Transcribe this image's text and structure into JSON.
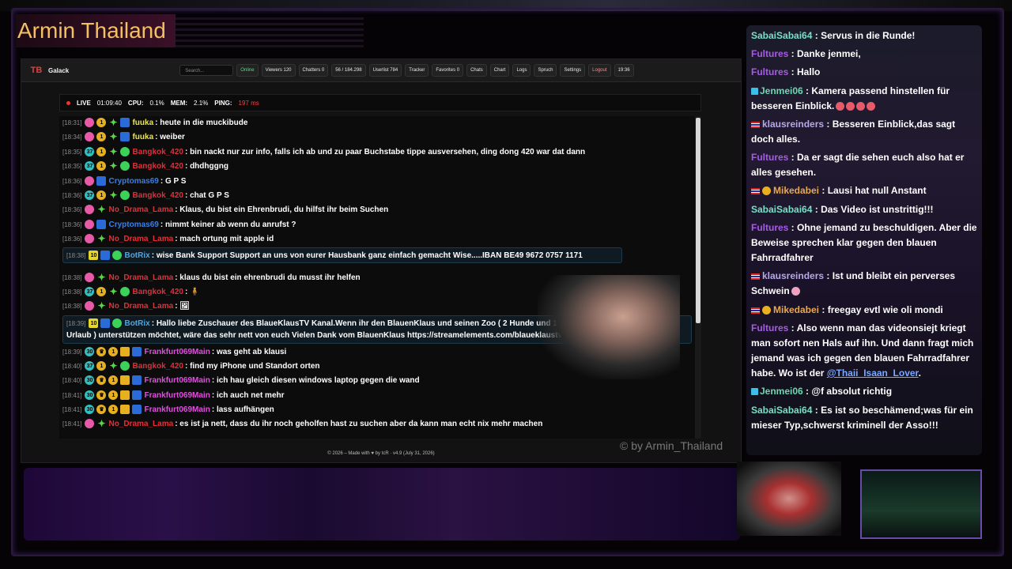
{
  "stream": {
    "title": "Armin Thailand",
    "watermark": "© by Armin_Thailand"
  },
  "app": {
    "logo": "TB",
    "name": "Galack",
    "search_placeholder": "Search...",
    "nav": {
      "online": "Online",
      "viewers": "Viewers 120",
      "chatters": "Chatters 0",
      "messages": "56 / 184.298",
      "userlist": "Userlist 784",
      "tracker": "Tracker",
      "favorites": "Favorites 0",
      "chats": "Chats",
      "chart": "Chart",
      "logs": "Logs",
      "spruch": "Spruch",
      "settings": "Settings",
      "logout": "Logout",
      "time": "19:36"
    },
    "status": {
      "live_label": "LIVE",
      "live_time": "01:09:40",
      "cpu_label": "CPU:",
      "cpu_val": "0.1%",
      "mem_label": "MEM:",
      "mem_val": "2.1%",
      "ping_label": "PING:",
      "ping_val": "197 ms"
    },
    "footer": "© 2026 – Made with ♥ by tcR · v4.9 (July 31, 2026)"
  },
  "chat": [
    {
      "ts": "[18:31]",
      "user": "fuuka",
      "text": "heute in die muckibude"
    },
    {
      "ts": "[18:34]",
      "user": "fuuka",
      "text": "weiber"
    },
    {
      "ts": "[18:35]",
      "user": "Bangkok_420",
      "text": "bin nackt nur zur info, falls ich ab und zu paar Buchstabe tippe ausversehen, ding dong 420 war dat dann"
    },
    {
      "ts": "[18:35]",
      "user": "Bangkok_420",
      "text": "dhdhggng"
    },
    {
      "ts": "[18:36]",
      "user": "Cryptomas69",
      "text": "G P S"
    },
    {
      "ts": "[18:36]",
      "user": "Bangkok_420",
      "text": "chat G P S"
    },
    {
      "ts": "[18:36]",
      "user": "No_Drama_Lama",
      "text": "Klaus, du bist ein Ehrenbrudi, du hilfst ihr beim Suchen"
    },
    {
      "ts": "[18:36]",
      "user": "Cryptomas69",
      "text": "nimmt keiner ab wenn du anrufst ?"
    },
    {
      "ts": "[18:36]",
      "user": "No_Drama_Lama",
      "text": "mach ortung mit apple id"
    },
    {
      "ts": "[18:38]",
      "user": "BotRix",
      "badge": "10",
      "text": "wise Bank Support Support an uns von eurer Hausbank ganz einfach gemacht Wise.....IBAN BE49 9672 0757 1171"
    },
    {
      "ts": "[18:38]",
      "user": "No_Drama_Lama",
      "text": "klaus du bist ein ehrenbrudi du musst ihr helfen"
    },
    {
      "ts": "[18:38]",
      "user": "Bangkok_420",
      "text": "🧍"
    },
    {
      "ts": "[18:38]",
      "user": "No_Drama_Lama",
      "text": "🖼"
    },
    {
      "ts": "[18:39]",
      "user": "BotRix",
      "badge": "10",
      "text": "Hallo liebe Zuschauer des BlaueKlausTV Kanal.Wenn ihr den BlauenKlaus und seinen Zoo ( 2 Hunde und 1 Katze Mietzi ist auf",
      "text2": "Urlaub ) unterstützen möchtet, wäre das sehr nett von euch Vielen Dank vom BlauenKlaus https://streamelements.com/blaueklaustv/tip"
    },
    {
      "ts": "[18:39]",
      "user": "Frankfurt069Main",
      "text": "was geht ab klausi"
    },
    {
      "ts": "[18:40]",
      "user": "Bangkok_420",
      "text": "find my iPhone und Standort orten"
    },
    {
      "ts": "[18:40]",
      "user": "Frankfurt069Main",
      "text": "ich hau gleich diesen windows laptop gegen die wand"
    },
    {
      "ts": "[18:41]",
      "user": "Frankfurt069Main",
      "text": "ich auch net mehr"
    },
    {
      "ts": "[18:41]",
      "user": "Frankfurt069Main",
      "text": "lass aufhängen"
    },
    {
      "ts": "[18:41]",
      "user": "No_Drama_Lama",
      "text": "es ist ja nett, dass du ihr noch geholfen hast zu suchen aber da kann man echt nix mehr machen"
    }
  ],
  "right_chat": [
    {
      "name": "SabaiSabai64",
      "text": "Servus in die Runde!"
    },
    {
      "name": "Fultures",
      "text": "Danke jenmei,"
    },
    {
      "name": "Fultures",
      "text": "Hallo"
    },
    {
      "name": "Jenmei06",
      "text": "Kamera passend hinstellen für besseren Einblick."
    },
    {
      "name": "klausreinders",
      "text": "Besseren Einblick,das sagt doch alles."
    },
    {
      "name": "Fultures",
      "text": "Da er sagt die sehen euch also hat er alles gesehen."
    },
    {
      "name": "Mikedabei",
      "text": "Lausi hat null Anstant"
    },
    {
      "name": "SabaiSabai64",
      "text": "Das Video ist unstrittig!!!"
    },
    {
      "name": "Fultures",
      "text": "Ohne jemand zu beschuldigen. Aber die Beweise sprechen klar gegen den blauen Fahrradfahrer"
    },
    {
      "name": "klausreinders",
      "text": "Ist und bleibt ein perverses Schwein"
    },
    {
      "name": "Mikedabei",
      "text": "freegay evtl wie oli mondi"
    },
    {
      "name": "Fultures",
      "text": "Also wenn man das videonsiejt kriegt man sofort nen Hals auf ihn. Und dann fragt mich jemand was ich gegen den blauen Fahrradfahrer habe. Wo ist der",
      "mention": "@Thaii_Isaan_Lover",
      "after": "."
    },
    {
      "name": "Jenmei06",
      "text": "@f absolut richtig"
    },
    {
      "name": "SabaiSabai64",
      "text": "Es ist so beschämend;was für ein mieser Typ,schwerst kriminell der Asso!!!"
    }
  ]
}
